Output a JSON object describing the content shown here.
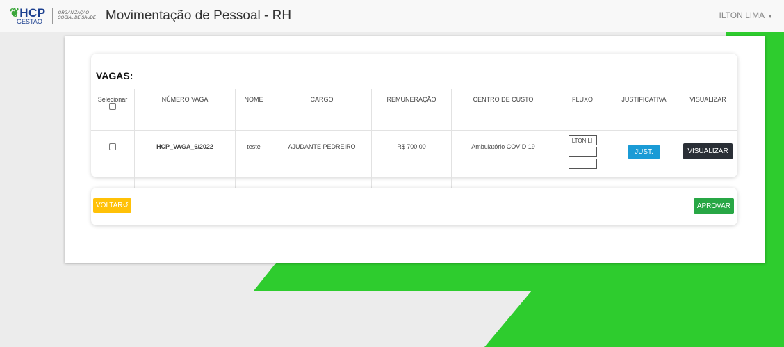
{
  "brand": {
    "logo_hcp": "HCP",
    "logo_sub": "GESTAO",
    "org_line1": "ORGANIZAÇÃO",
    "org_line2": "SOCIAL DE SAÚDE",
    "green": "#2ecc2e"
  },
  "header": {
    "title": "Movimentação de Pessoal - RH",
    "user": "ILTON LIMA"
  },
  "vagas": {
    "title": "VAGAS:",
    "columns": {
      "selecionar": "Selecionar",
      "numero": "NÚMERO VAGA",
      "nome": "NOME",
      "cargo": "CARGO",
      "remuneracao": "REMUNERAÇÃO",
      "centro": "CENTRO DE CUSTO",
      "fluxo": "FLUXO",
      "justificativa": "JUSTIFICATIVA",
      "visualizar": "VISUALIZAR"
    },
    "rows": [
      {
        "numero": "HCP_VAGA_6/2022",
        "nome": "teste",
        "cargo": "AJUDANTE PEDREIRO",
        "remuneracao": "R$ 700,00",
        "centro": "Ambulatório COVID 19",
        "fluxo": [
          "ILTON LI",
          "",
          ""
        ],
        "just_button": "JUST.",
        "visualizar_button": "VISUALIZAR"
      }
    ]
  },
  "actions": {
    "voltar": "VOLTAR",
    "aprovar": "APROVAR"
  }
}
